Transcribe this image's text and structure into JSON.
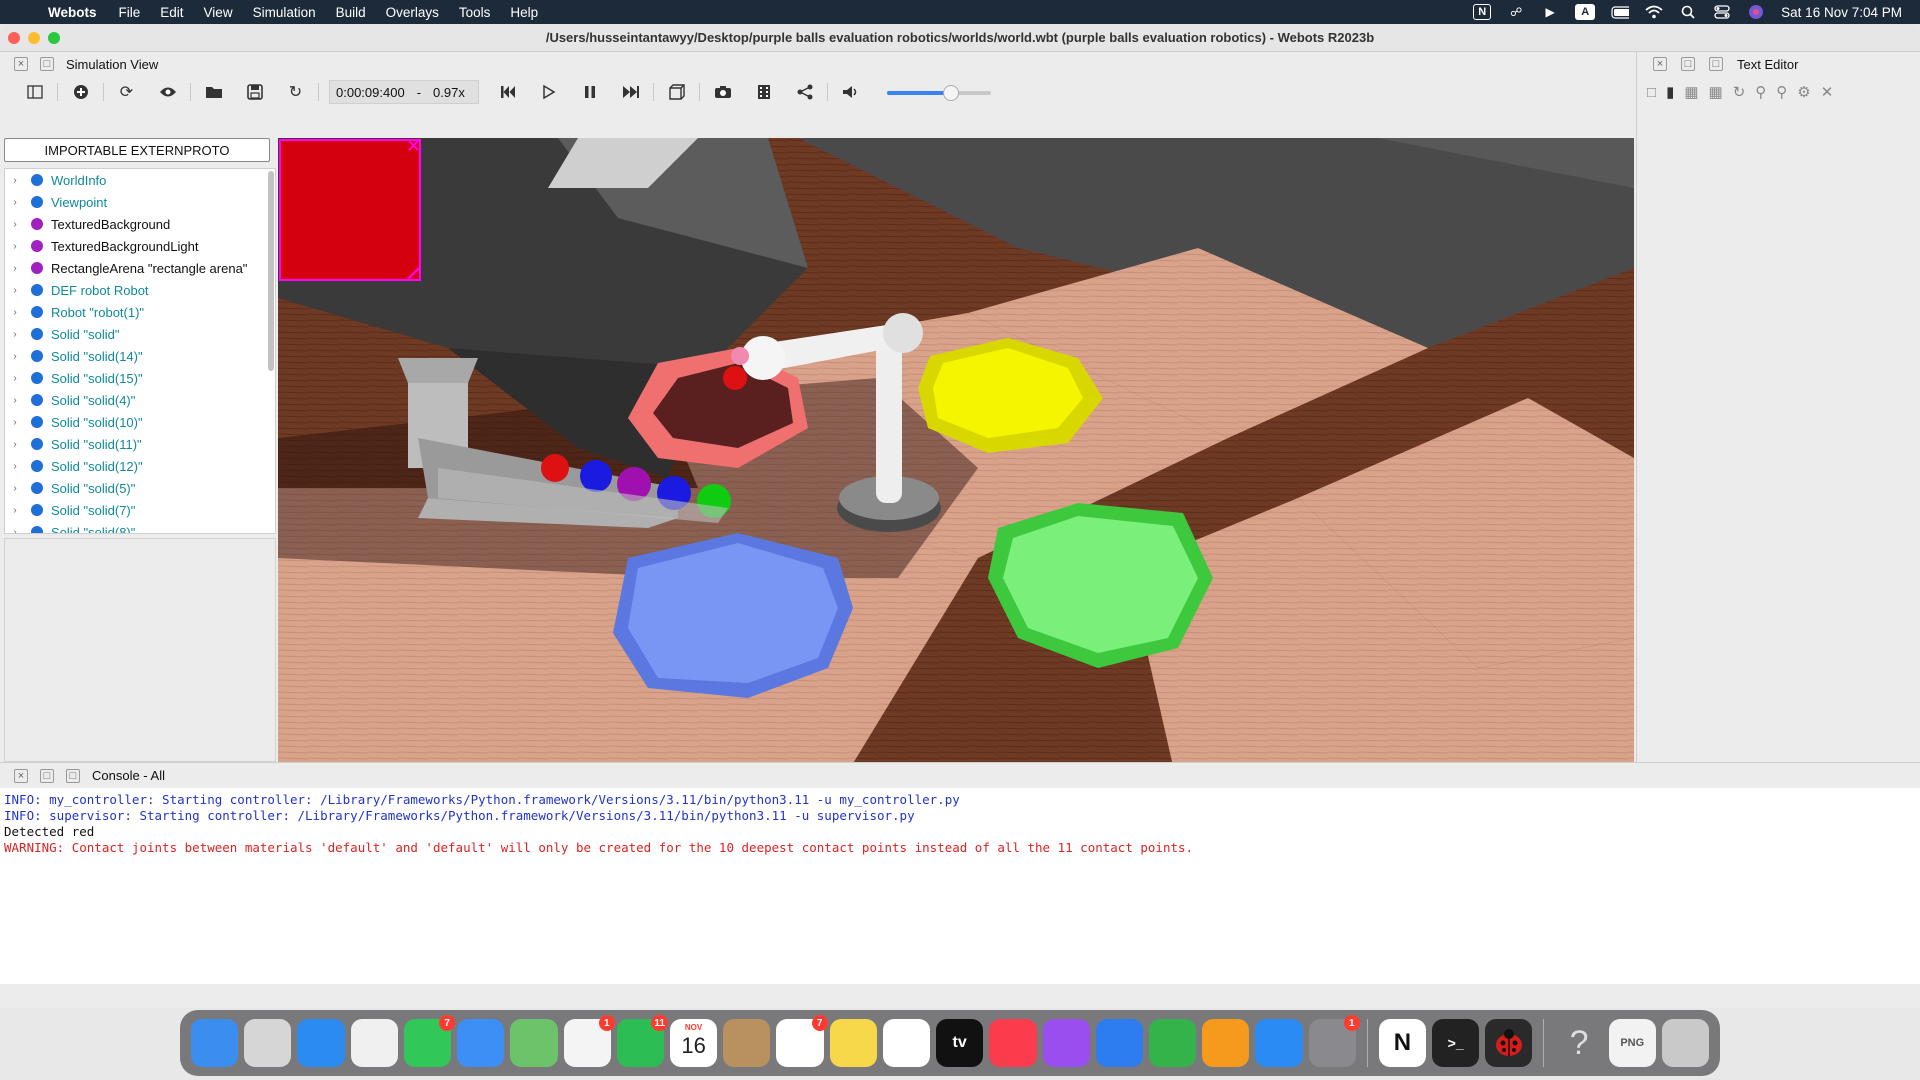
{
  "menubar": {
    "app_name": "Webots",
    "items": [
      "File",
      "Edit",
      "View",
      "Simulation",
      "Build",
      "Overlays",
      "Tools",
      "Help"
    ],
    "status_icons": [
      "notion-icon",
      "creative-cloud-icon",
      "play-circle-icon",
      "input-source-icon",
      "battery-icon",
      "wifi-icon",
      "search-icon",
      "control-center-icon",
      "siri-icon"
    ],
    "input_source_label": "A",
    "notion_label": "N",
    "datetime": "Sat 16 Nov  7:04 PM"
  },
  "window": {
    "title": "/Users/husseintantawyy/Desktop/purple balls evaluation robotics/worlds/world.wbt (purple balls evaluation robotics) - Webots R2023b"
  },
  "simulation_view": {
    "title": "Simulation View",
    "time": "0:00:09:400",
    "separator": "-",
    "speed": "0.97x",
    "volume_level": 0.62
  },
  "scene_tree": {
    "extern_button": "IMPORTABLE EXTERNPROTO",
    "items": [
      {
        "label": "WorldInfo",
        "color": "#1e6fd9",
        "link": true
      },
      {
        "label": "Viewpoint",
        "color": "#1e6fd9",
        "link": true
      },
      {
        "label": "TexturedBackground",
        "color": "#a020c0",
        "link": false
      },
      {
        "label": "TexturedBackgroundLight",
        "color": "#a020c0",
        "link": false
      },
      {
        "label": "RectangleArena \"rectangle arena\"",
        "color": "#a020c0",
        "link": false
      },
      {
        "label": "DEF robot Robot",
        "color": "#1e6fd9",
        "link": true
      },
      {
        "label": "Robot \"robot(1)\"",
        "color": "#1e6fd9",
        "link": true
      },
      {
        "label": "Solid \"solid\"",
        "color": "#1e6fd9",
        "link": true
      },
      {
        "label": "Solid \"solid(14)\"",
        "color": "#1e6fd9",
        "link": true
      },
      {
        "label": "Solid \"solid(15)\"",
        "color": "#1e6fd9",
        "link": true
      },
      {
        "label": "Solid \"solid(4)\"",
        "color": "#1e6fd9",
        "link": true
      },
      {
        "label": "Solid \"solid(10)\"",
        "color": "#1e6fd9",
        "link": true
      },
      {
        "label": "Solid \"solid(11)\"",
        "color": "#1e6fd9",
        "link": true
      },
      {
        "label": "Solid \"solid(12)\"",
        "color": "#1e6fd9",
        "link": true
      },
      {
        "label": "Solid \"solid(5)\"",
        "color": "#1e6fd9",
        "link": true
      },
      {
        "label": "Solid \"solid(7)\"",
        "color": "#1e6fd9",
        "link": true
      },
      {
        "label": "Solid \"solid(8)\"",
        "color": "#1e6fd9",
        "link": true
      }
    ]
  },
  "text_editor": {
    "title": "Text Editor"
  },
  "console": {
    "title": "Console - All",
    "lines": [
      {
        "kind": "info",
        "text": "INFO: my_controller: Starting controller: /Library/Frameworks/Python.framework/Versions/3.11/bin/python3.11 -u my_controller.py"
      },
      {
        "kind": "info",
        "text": "INFO: supervisor: Starting controller: /Library/Frameworks/Python.framework/Versions/3.11/bin/python3.11 -u supervisor.py"
      },
      {
        "kind": "plain",
        "text": "Detected red"
      },
      {
        "kind": "warn",
        "text": "WARNING: Contact joints between materials 'default' and 'default' will only be created for the 10 deepest contact points instead of all the 11 contact points."
      }
    ]
  },
  "dock": {
    "apps": [
      {
        "name": "finder-icon",
        "color": "#3a8ef0",
        "badge": ""
      },
      {
        "name": "launchpad-icon",
        "color": "#d6d6d6",
        "badge": ""
      },
      {
        "name": "safari-icon",
        "color": "#2c8bf0",
        "badge": ""
      },
      {
        "name": "chrome-icon",
        "color": "#f0f0f0",
        "badge": ""
      },
      {
        "name": "messages-icon",
        "color": "#32c759",
        "badge": "7"
      },
      {
        "name": "mail-icon",
        "color": "#3b8ff5",
        "badge": ""
      },
      {
        "name": "maps-icon",
        "color": "#6cc36a",
        "badge": ""
      },
      {
        "name": "photos-icon",
        "color": "#f4f4f4",
        "badge": "1"
      },
      {
        "name": "facetime-icon",
        "color": "#2dbd55",
        "badge": "11"
      },
      {
        "name": "calendar-icon",
        "color": "#ffffff",
        "badge": ""
      },
      {
        "name": "contacts-icon",
        "color": "#b8915e",
        "badge": ""
      },
      {
        "name": "reminders-icon",
        "color": "#ffffff",
        "badge": "7"
      },
      {
        "name": "notes-icon",
        "color": "#f7d84a",
        "badge": ""
      },
      {
        "name": "freeform-icon",
        "color": "#ffffff",
        "badge": ""
      },
      {
        "name": "tv-icon",
        "color": "#111111",
        "badge": ""
      },
      {
        "name": "music-icon",
        "color": "#fa3c4c",
        "badge": ""
      },
      {
        "name": "podcasts-icon",
        "color": "#9a4ef0",
        "badge": ""
      },
      {
        "name": "keynote-icon",
        "color": "#2d7cf0",
        "badge": ""
      },
      {
        "name": "numbers-icon",
        "color": "#33b34a",
        "badge": ""
      },
      {
        "name": "pages-icon",
        "color": "#f59a1d",
        "badge": ""
      },
      {
        "name": "app-store-icon",
        "color": "#2a8bf5",
        "badge": ""
      },
      {
        "name": "system-settings-icon",
        "color": "#8a8a8e",
        "badge": "1"
      }
    ],
    "calendar": {
      "month": "NOV",
      "day": "16"
    },
    "tv_label": "tv",
    "recent": [
      {
        "name": "notion-icon",
        "color": "#ffffff",
        "label": "N"
      },
      {
        "name": "terminal-icon",
        "color": "#222222",
        "label": ">_"
      },
      {
        "name": "webots-icon",
        "color": "#2a2a2a",
        "label": ""
      }
    ],
    "others": [
      {
        "name": "help-icon",
        "color": "transparent",
        "label": "?"
      },
      {
        "name": "png-file-icon",
        "color": "#f2f2f2",
        "label": "PNG"
      },
      {
        "name": "trash-icon",
        "color": "#c9c9c9",
        "label": ""
      }
    ]
  }
}
